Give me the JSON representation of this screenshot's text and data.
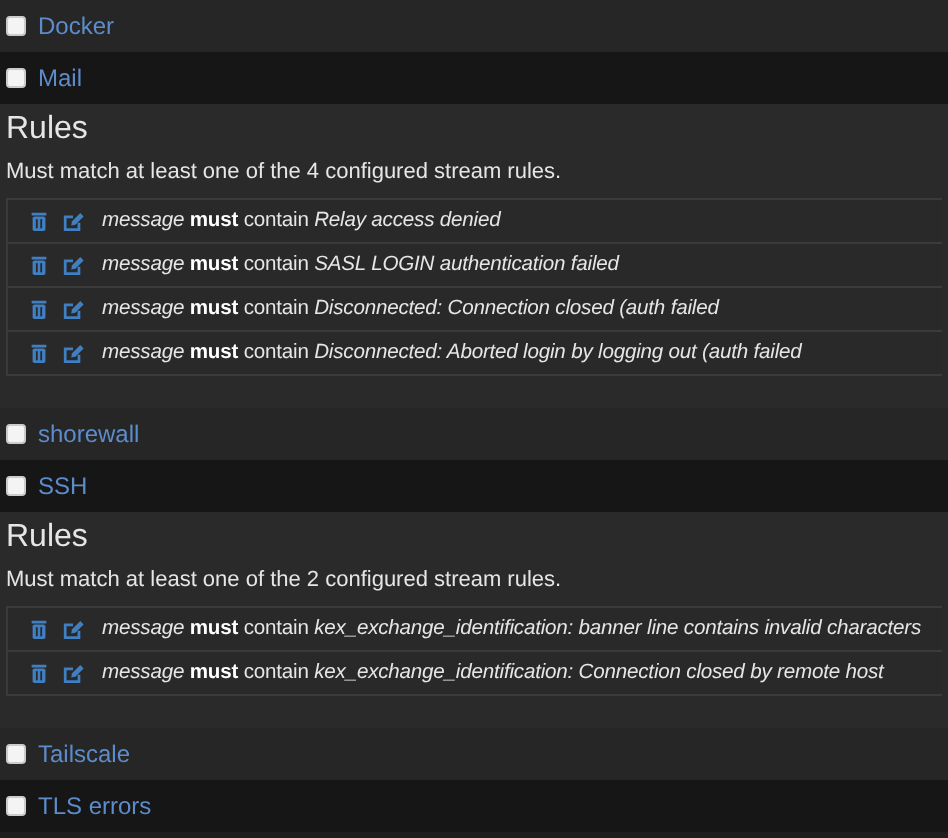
{
  "streams": [
    {
      "name": "Docker",
      "checked": false
    },
    {
      "name": "Mail",
      "checked": false,
      "rules": {
        "title": "Rules",
        "description": "Must match at least one of the 4 configured stream rules.",
        "items": [
          "*message* **must** contain *Relay access denied*",
          "*message* **must** contain *SASL LOGIN authentication failed*",
          "*message* **must** contain *Disconnected: Connection closed (auth failed*",
          "*message* **must** contain *Disconnected: Aborted login by logging out (auth failed*"
        ]
      }
    },
    {
      "name": "shorewall",
      "checked": false
    },
    {
      "name": "SSH",
      "checked": false,
      "rules": {
        "title": "Rules",
        "description": "Must match at least one of the 2 configured stream rules.",
        "items": [
          "*message* **must** contain *kex_exchange_identification: banner line contains invalid characters*",
          "*message* **must** contain *kex_exchange_identification: Connection closed by remote host*"
        ]
      }
    },
    {
      "name": "Tailscale",
      "checked": false
    },
    {
      "name": "TLS errors",
      "checked": false
    }
  ]
}
